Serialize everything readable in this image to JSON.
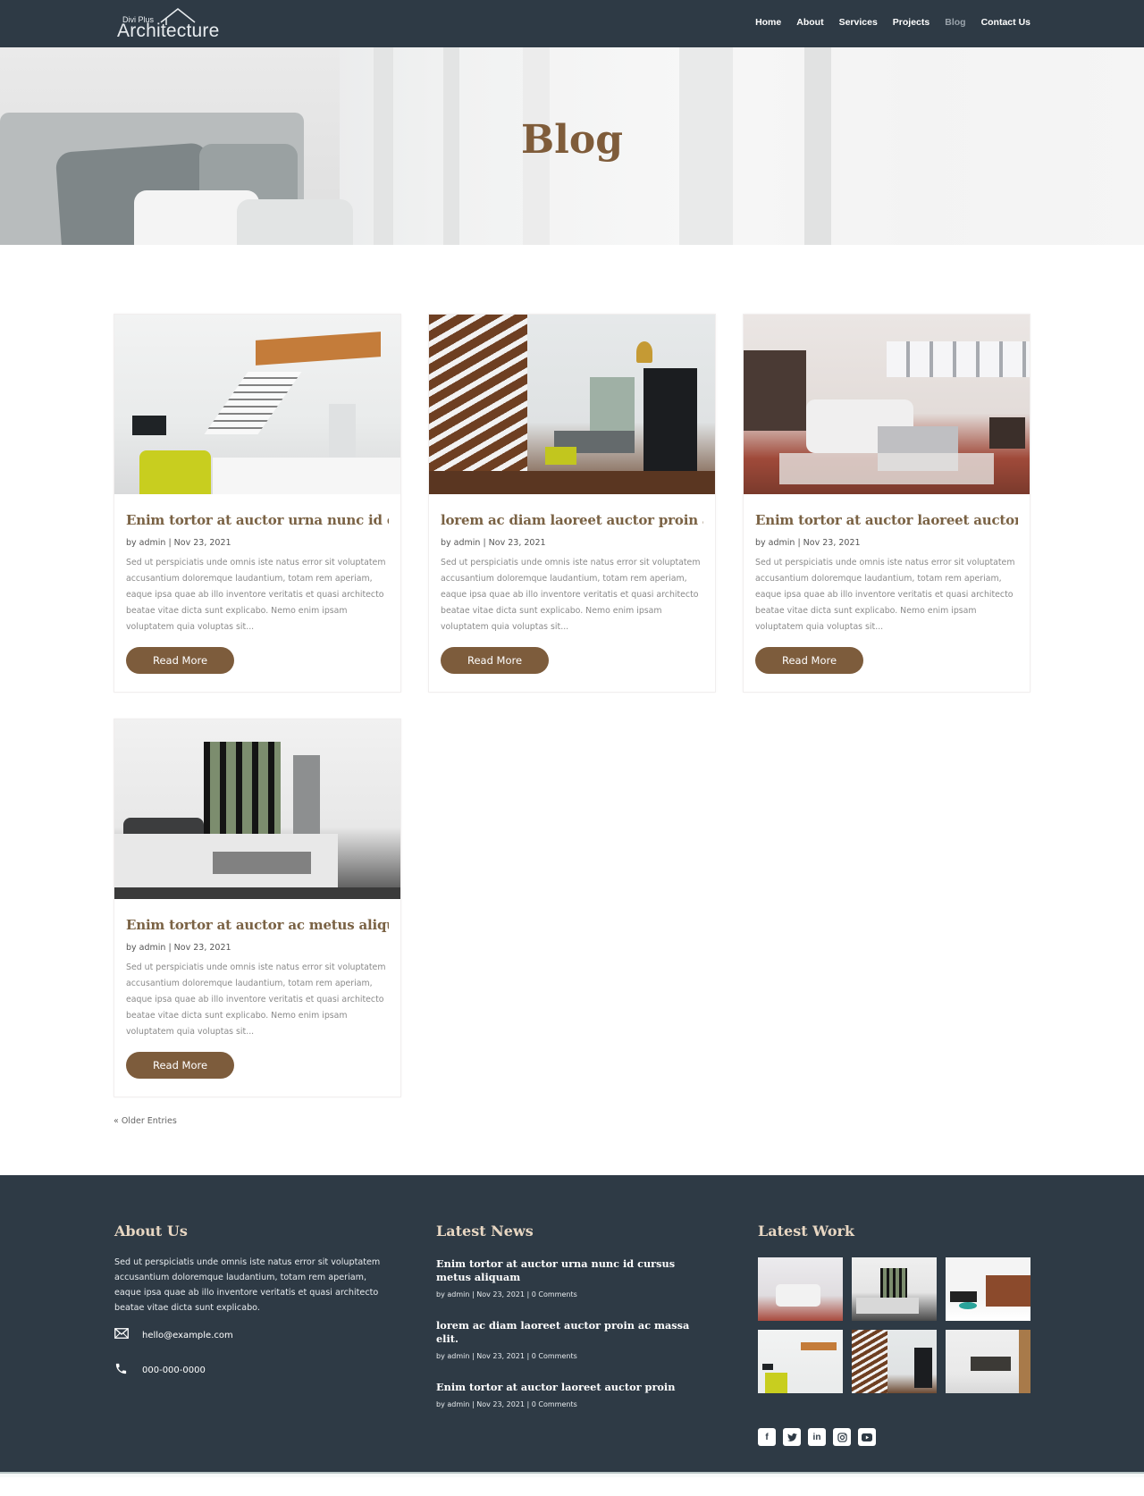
{
  "header": {
    "logo_small": "Divi Plus",
    "logo_big": "Architecture",
    "nav": [
      {
        "label": "Home",
        "active": false
      },
      {
        "label": "About",
        "active": false
      },
      {
        "label": "Services",
        "active": false
      },
      {
        "label": "Projects",
        "active": false
      },
      {
        "label": "Blog",
        "active": true
      },
      {
        "label": "Contact Us",
        "active": false
      }
    ]
  },
  "hero": {
    "title": "Blog"
  },
  "posts": [
    {
      "title": "Enim tortor at auctor urna nunc id cursus metus aliquam",
      "author": "admin",
      "date": "Nov 23, 2021",
      "meta": "by admin | Nov 23, 2021",
      "excerpt": "Sed ut perspiciatis unde omnis iste natus error sit voluptatem accusantium doloremque laudantium, totam rem aperiam, eaque ipsa quae ab illo inventore veritatis et quasi architecto beatae vitae dicta sunt explicabo. Nemo enim ipsam voluptatem quia voluptas sit...",
      "button": "Read More",
      "image": "white-loft-interior-with-floating-stairs"
    },
    {
      "title": "lorem ac diam laoreet auctor proin ac massa elit.",
      "author": "admin",
      "date": "Nov 23, 2021",
      "meta": "by admin | Nov 23, 2021",
      "excerpt": "Sed ut perspiciatis unde omnis iste natus error sit voluptatem accusantium doloremque laudantium, totam rem aperiam, eaque ipsa quae ab illo inventore veritatis et quasi architecto beatae vitae dicta sunt explicabo. Nemo enim ipsam voluptatem quia voluptas sit...",
      "button": "Read More",
      "image": "wooden-staircase-living-room"
    },
    {
      "title": "Enim tortor at auctor laoreet auctor proin",
      "author": "admin",
      "date": "Nov 23, 2021",
      "meta": "by admin | Nov 23, 2021",
      "excerpt": "Sed ut perspiciatis unde omnis iste natus error sit voluptatem accusantium doloremque laudantium, totam rem aperiam, eaque ipsa quae ab illo inventore veritatis et quasi architecto beatae vitae dicta sunt explicabo. Nemo enim ipsam voluptatem quia voluptas sit...",
      "button": "Read More",
      "image": "open-plan-kitchen-living-room"
    },
    {
      "title": "Enim tortor at auctor ac metus aliquam",
      "author": "admin",
      "date": "Nov 23, 2021",
      "meta": "by admin | Nov 23, 2021",
      "excerpt": "Sed ut perspiciatis unde omnis iste natus error sit voluptatem accusantium doloremque laudantium, totam rem aperiam, eaque ipsa quae ab illo inventore veritatis et quasi architecto beatae vitae dicta sunt explicabo. Nemo enim ipsam voluptatem quia voluptas sit...",
      "button": "Read More",
      "image": "modern-bedroom-with-tall-windows"
    }
  ],
  "pagination": {
    "older": "« Older Entries"
  },
  "footer": {
    "about": {
      "heading": "About Us",
      "text": "Sed ut perspiciatis unde omnis iste natus error sit voluptatem accusantium doloremque laudantium, totam rem aperiam, eaque ipsa quae ab illo inventore veritatis et quasi architecto beatae vitae dicta sunt explicabo.",
      "email": "hello@example.com",
      "phone": "000-000-0000"
    },
    "news": {
      "heading": "Latest News",
      "items": [
        {
          "title": "Enim tortor at auctor urna nunc id cursus metus aliquam",
          "meta": "by admin | Nov 23, 2021 | 0 Comments"
        },
        {
          "title": "lorem ac diam laoreet auctor proin ac massa elit.",
          "meta": "by admin | Nov 23, 2021 | 0 Comments"
        },
        {
          "title": "Enim tortor at auctor laoreet auctor proin",
          "meta": "by admin | Nov 23, 2021 | 0 Comments"
        }
      ]
    },
    "work": {
      "heading": "Latest Work",
      "thumbs": [
        "open-kitchen",
        "bedroom",
        "brick-bar-lounge",
        "white-loft",
        "wooden-stairs",
        "living-room-sofa"
      ]
    },
    "social": [
      {
        "name": "facebook",
        "glyph": "f"
      },
      {
        "name": "twitter",
        "glyph": "t"
      },
      {
        "name": "linkedin",
        "glyph": "in"
      },
      {
        "name": "instagram",
        "glyph": "◎"
      },
      {
        "name": "youtube",
        "glyph": "▶"
      }
    ]
  }
}
